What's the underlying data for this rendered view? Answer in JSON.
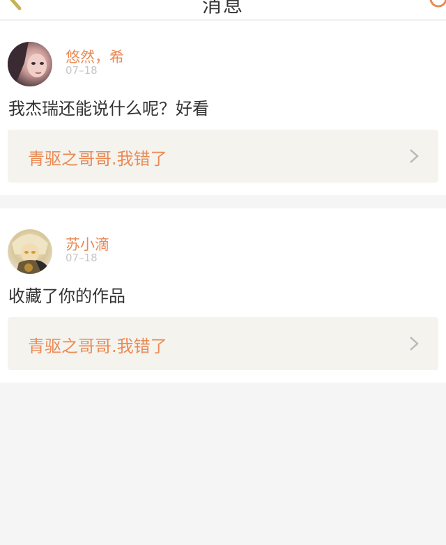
{
  "header": {
    "title": "消息"
  },
  "messages": [
    {
      "username": "悠然，希",
      "date": "07–18",
      "content": "我杰瑞还能说什么呢？好看",
      "work_link": "青驱之哥哥.我错了"
    },
    {
      "username": "苏小滴",
      "date": "07–18",
      "content": "收藏了你的作品",
      "work_link": "青驱之哥哥.我错了"
    }
  ],
  "colors": {
    "accent": "#ea8a55",
    "link_box_bg": "#f4f3ee",
    "page_bg": "#f5f5f5",
    "text": "#333333",
    "muted": "#c6c6c6"
  },
  "icons": [
    "back-icon",
    "user-icon",
    "chevron-right-icon"
  ]
}
